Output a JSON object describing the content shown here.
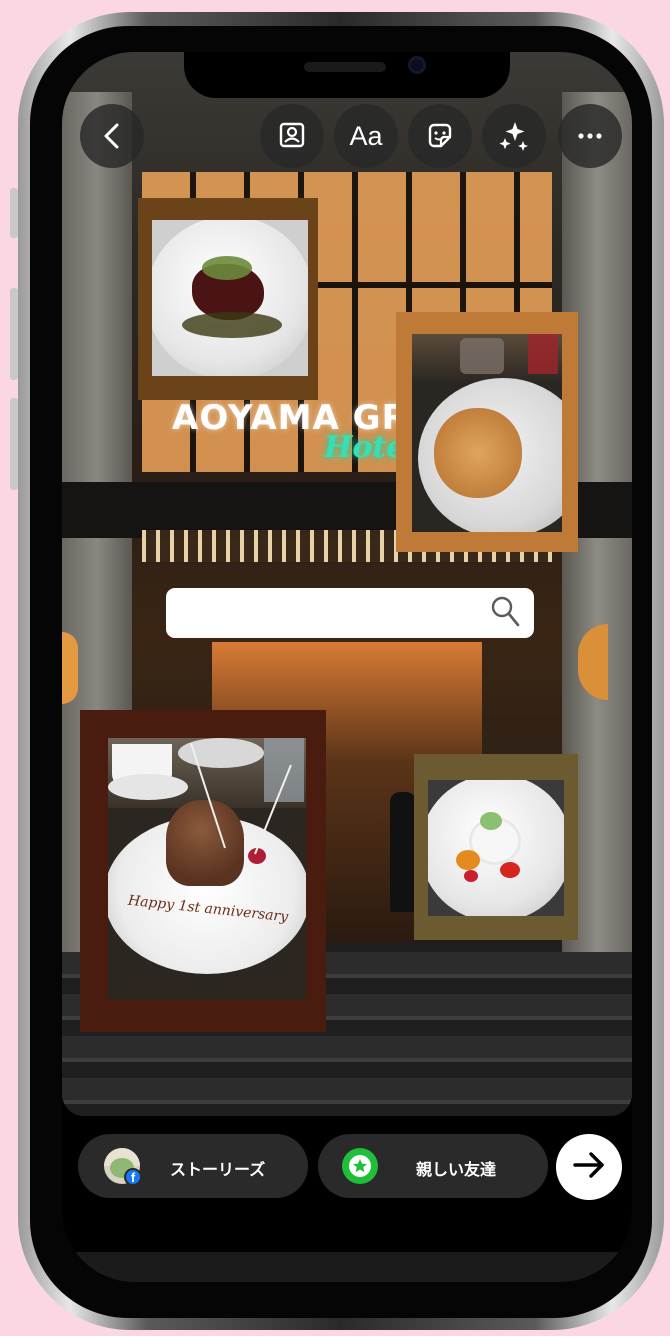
{
  "top_bar": {
    "back_icon": "chevron-left-icon",
    "tools": [
      {
        "name": "mention-icon",
        "label": ""
      },
      {
        "name": "text-tool",
        "label": "Aa"
      },
      {
        "name": "sticker-icon",
        "label": ""
      },
      {
        "name": "effects-sparkle-icon",
        "label": ""
      },
      {
        "name": "more-icon",
        "label": ""
      }
    ]
  },
  "story": {
    "background_sign": "AOYAMA GR",
    "background_sign_sub": "Hotel",
    "search_sticker_icon": "search-icon",
    "stickers": [
      {
        "name": "photo-sticker-beef",
        "frame_color": "#6b4319"
      },
      {
        "name": "photo-sticker-pasta",
        "frame_color": "#c07a37"
      },
      {
        "name": "photo-sticker-cake",
        "frame_color": "#4a1c10",
        "plate_text": "Happy 1st anniversary"
      },
      {
        "name": "photo-sticker-dessert",
        "frame_color": "#6c5a30"
      }
    ]
  },
  "share_bar": {
    "your_story_label": "ストーリーズ",
    "close_friends_label": "親しい友達",
    "send_icon": "arrow-right-icon"
  },
  "colors": {
    "background": "#fbd7e3",
    "close_friends": "#1fbf3a",
    "hotel_neon": "#35e0b6"
  }
}
